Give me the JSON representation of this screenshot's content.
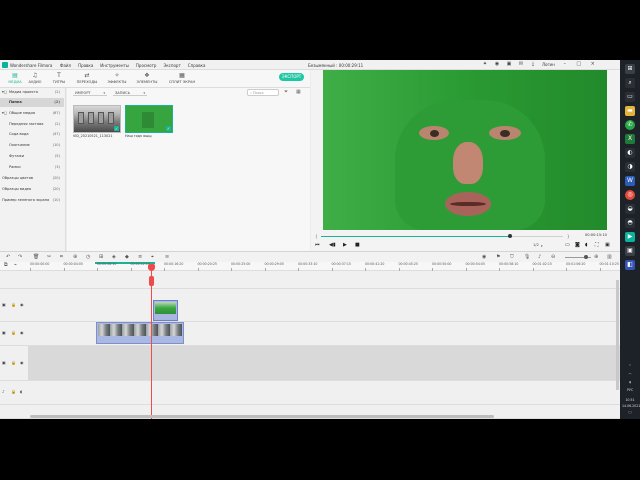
{
  "app": {
    "name": "Wondershare Filmora",
    "menu": [
      "Файл",
      "Правка",
      "Инструменты",
      "Просмотр",
      "Экспорт",
      "Справка"
    ],
    "document_title": "Безымянный : 00:00:29:11",
    "login_label": "Логин"
  },
  "toolbar": {
    "tabs": [
      {
        "label": "МЕДИА",
        "icon": "media-icon",
        "active": true
      },
      {
        "label": "АУДИО",
        "icon": "audio-icon",
        "active": false
      },
      {
        "label": "ТИТРЫ",
        "icon": "titles-icon",
        "active": false
      },
      {
        "label": "ПЕРЕХОДЫ",
        "icon": "transitions-icon",
        "active": false
      },
      {
        "label": "ЭФФЕКТЫ",
        "icon": "effects-icon",
        "active": false
      },
      {
        "label": "ЭЛЕМЕНТЫ",
        "icon": "elements-icon",
        "active": false
      },
      {
        "label": "СПЛИТ ЭКРАН",
        "icon": "split-screen-icon",
        "active": false
      }
    ],
    "export_label": "ЭКСПОРТ"
  },
  "sidebar": {
    "items": [
      {
        "label": "Медиа проекта",
        "count": "(2)",
        "expandable": true,
        "selected": false
      },
      {
        "label": "Папка",
        "count": "(2)",
        "expandable": false,
        "selected": true
      },
      {
        "label": "Общие медиа",
        "count": "(67)",
        "expandable": true,
        "selected": false
      },
      {
        "label": "Передняя застава",
        "count": "(2)",
        "expandable": false,
        "selected": false
      },
      {
        "label": "Сода вода",
        "count": "(47)",
        "expandable": false,
        "selected": false
      },
      {
        "label": "Окончание",
        "count": "(10)",
        "expandable": false,
        "selected": false
      },
      {
        "label": "Футажи",
        "count": "(5)",
        "expandable": false,
        "selected": false
      },
      {
        "label": "Рамки",
        "count": "(3)",
        "expandable": false,
        "selected": false
      },
      {
        "label": "Образцы цветов",
        "count": "(20)",
        "expandable": false,
        "selected": false
      },
      {
        "label": "Образцы видео",
        "count": "(20)",
        "expandable": false,
        "selected": false
      },
      {
        "label": "Пример зеленого экрана",
        "count": "(10)",
        "expandable": false,
        "selected": false
      }
    ]
  },
  "media": {
    "import_label": "ИМПОРТ",
    "record_label": "ЗАПИСЬ",
    "search_placeholder": "Поиск",
    "items": [
      {
        "name": "VID_20210521_113021",
        "checked": true
      },
      {
        "name": "Наш годх ощщ",
        "checked": true
      }
    ]
  },
  "preview": {
    "progress": 0.78,
    "timecode": "00:00:15:10",
    "ratio_label": "1/2"
  },
  "timeline": {
    "ruler_ticks": [
      "00:00:00:00",
      "00:00:04:05",
      "00:00:08:10",
      "00:00:12:15",
      "00:00:16:20",
      "00:00:20:25",
      "00:00:25:00",
      "00:00:29:05",
      "00:00:33:10",
      "00:00:37:15",
      "00:00:41:20",
      "00:00:45:25",
      "00:00:50:00",
      "00:00:54:05",
      "00:00:58:10",
      "00:01:02:15",
      "00:01:06:20",
      "00:01:10:25"
    ]
  },
  "taskbar": {
    "lang": "РУС",
    "time": "10:51",
    "date": "14.06.2021"
  }
}
